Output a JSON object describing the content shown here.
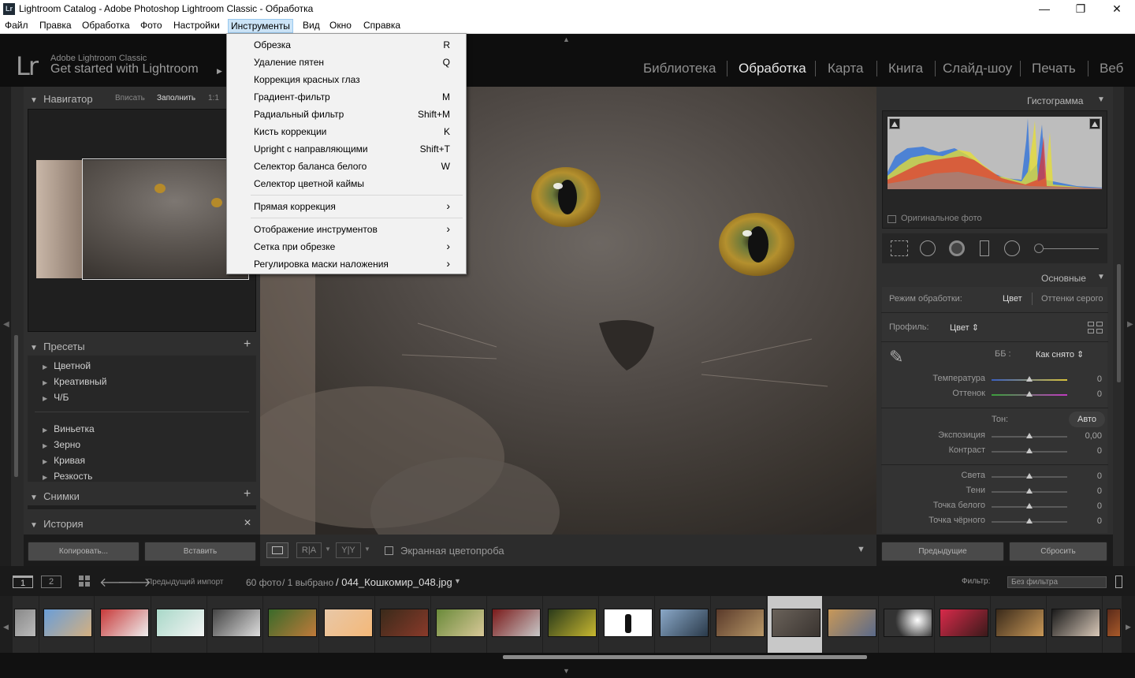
{
  "window": {
    "title": "Lightroom Catalog - Adobe Photoshop Lightroom Classic - Обработка",
    "minimize": "—",
    "maximize": "❐",
    "close": "✕"
  },
  "menubar": [
    "Файл",
    "Правка",
    "Обработка",
    "Фото",
    "Настройки",
    "Инструменты",
    "Вид",
    "Окно",
    "Справка"
  ],
  "brand": {
    "logo": "Lr",
    "line1": "Adobe Lightroom Classic",
    "line2": "Get started with Lightroom",
    "arrow": "▶"
  },
  "modules": [
    "Библиотека",
    "Обработка",
    "Карта",
    "Книга",
    "Слайд-шоу",
    "Печать",
    "Веб"
  ],
  "active_module": "Обработка",
  "navigator": {
    "title": "Навигатор",
    "opt1": "Вписать",
    "opt2": "Заполнить",
    "opt3": "1:1"
  },
  "presets": {
    "title": "Пресеты",
    "add": "+",
    "items": [
      "Цветной",
      "Креативный",
      "Ч/Б",
      "Виньетка",
      "Зерно",
      "Кривая",
      "Резкость"
    ]
  },
  "snapshots": {
    "title": "Снимки",
    "add": "+"
  },
  "history": {
    "title": "История",
    "clear": "✕"
  },
  "left_buttons": {
    "copy": "Копировать...",
    "paste": "Вставить"
  },
  "toolbar": {
    "softproof": "Экранная цветопроба",
    "ra": "R|A",
    "yy": "Y|Y"
  },
  "histogram": {
    "title": "Гистограмма",
    "original": "Оригинальное фото"
  },
  "basic": {
    "title": "Основные",
    "treatment_label": "Режим обработки:",
    "color": "Цвет",
    "bw": "Оттенки серого",
    "profile_label": "Профиль:",
    "profile_value": "Цвет ⇕",
    "wb_label": "ББ :",
    "wb_value": "Как снято ⇕",
    "tone_label": "Тон:",
    "auto": "Авто",
    "sliders": [
      {
        "label": "Температура",
        "value": "0"
      },
      {
        "label": "Оттенок",
        "value": "0"
      },
      {
        "label": "Экспозиция",
        "value": "0,00"
      },
      {
        "label": "Контраст",
        "value": "0"
      },
      {
        "label": "Света",
        "value": "0"
      },
      {
        "label": "Тени",
        "value": "0"
      },
      {
        "label": "Точка белого",
        "value": "0"
      },
      {
        "label": "Точка чёрного",
        "value": "0"
      }
    ]
  },
  "right_buttons": {
    "previous": "Предыдущие",
    "reset": "Сбросить"
  },
  "filmbar": {
    "view1": "1",
    "view2": "2",
    "source": "Предыдущий импорт",
    "count": "60 фото",
    "selected": "/ 1 выбрано",
    "filename": "/ 044_Кошкомир_048.jpg",
    "filter_label": "Фильтр:",
    "filter_value": "Без фильтра"
  },
  "tools_menu": {
    "items": [
      {
        "label": "Обрезка",
        "key": "R"
      },
      {
        "label": "Удаление пятен",
        "key": "Q"
      },
      {
        "label": "Коррекция красных глаз",
        "key": ""
      },
      {
        "label": "Градиент-фильтр",
        "key": "M"
      },
      {
        "label": "Радиальный фильтр",
        "key": "Shift+M"
      },
      {
        "label": "Кисть коррекции",
        "key": "K"
      },
      {
        "label": "Upright с направляющими",
        "key": "Shift+T"
      },
      {
        "label": "Селектор баланса белого",
        "key": "W"
      },
      {
        "label": "Селектор цветной каймы",
        "key": ""
      },
      {
        "label": "Прямая коррекция",
        "key": "›"
      },
      {
        "label": "Отображение инструментов",
        "key": "›"
      },
      {
        "label": "Сетка при обрезке",
        "key": "›"
      },
      {
        "label": "Регулировка маски наложения",
        "key": "›"
      }
    ]
  },
  "colors": {
    "accent_menu": "#cce4f7",
    "panel_bg": "#2f2f2f",
    "topbar_bg": "#0e0e0e"
  }
}
